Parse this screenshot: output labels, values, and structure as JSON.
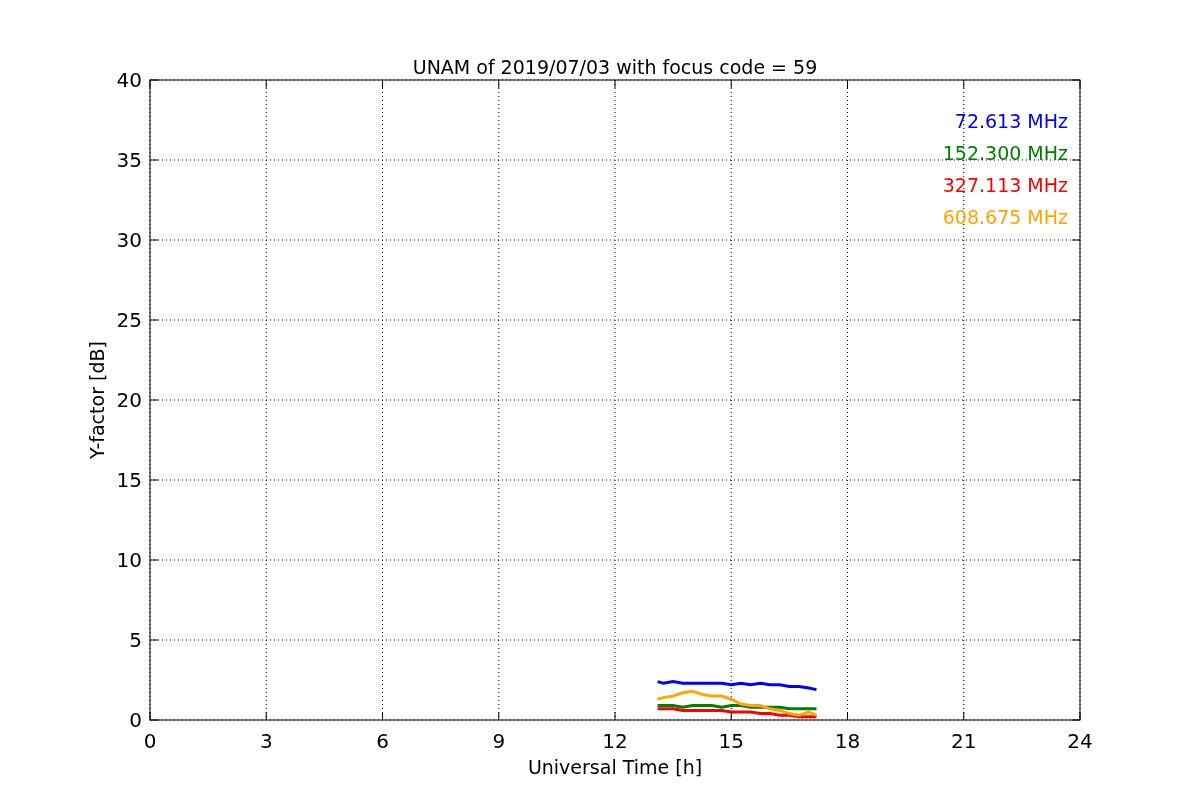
{
  "figure": {
    "chart_data": {
      "type": "line",
      "title": "UNAM of 2019/07/03 with focus code = 59",
      "xlabel": "Universal Time [h]",
      "ylabel": "Y-factor [dB]",
      "x": [
        13.1,
        13.25,
        13.5,
        13.75,
        14,
        14.25,
        14.5,
        14.75,
        15,
        15.25,
        15.5,
        15.75,
        16,
        16.25,
        16.5,
        16.75,
        17,
        17.2
      ],
      "series": [
        {
          "name": "72.613 MHz",
          "color": "#0000ff",
          "values": [
            2.4,
            2.3,
            2.4,
            2.3,
            2.3,
            2.3,
            2.3,
            2.3,
            2.2,
            2.3,
            2.2,
            2.3,
            2.2,
            2.2,
            2.1,
            2.1,
            2.0,
            1.9
          ]
        },
        {
          "name": "152.300 MHz",
          "color": "#008000",
          "values": [
            0.9,
            0.9,
            0.9,
            0.8,
            0.9,
            0.9,
            0.9,
            0.8,
            0.9,
            0.9,
            0.8,
            0.8,
            0.8,
            0.8,
            0.7,
            0.7,
            0.7,
            0.7
          ]
        },
        {
          "name": "327.113 MHz",
          "color": "#ff0000",
          "values": [
            0.7,
            0.7,
            0.7,
            0.6,
            0.6,
            0.6,
            0.6,
            0.6,
            0.5,
            0.5,
            0.5,
            0.4,
            0.4,
            0.3,
            0.3,
            0.2,
            0.2,
            0.2
          ]
        },
        {
          "name": "608.675 MHz",
          "color": "#ffa500",
          "values": [
            1.3,
            1.4,
            1.5,
            1.7,
            1.8,
            1.6,
            1.5,
            1.5,
            1.3,
            1.0,
            0.9,
            0.9,
            0.7,
            0.6,
            0.4,
            0.3,
            0.5,
            0.3
          ]
        }
      ],
      "xlim": [
        0,
        24
      ],
      "ylim": [
        0,
        40
      ],
      "xticks": [
        0,
        3,
        6,
        9,
        12,
        15,
        18,
        21,
        24
      ],
      "yticks": [
        0,
        5,
        10,
        15,
        20,
        25,
        30,
        35,
        40
      ],
      "grid": true
    }
  }
}
